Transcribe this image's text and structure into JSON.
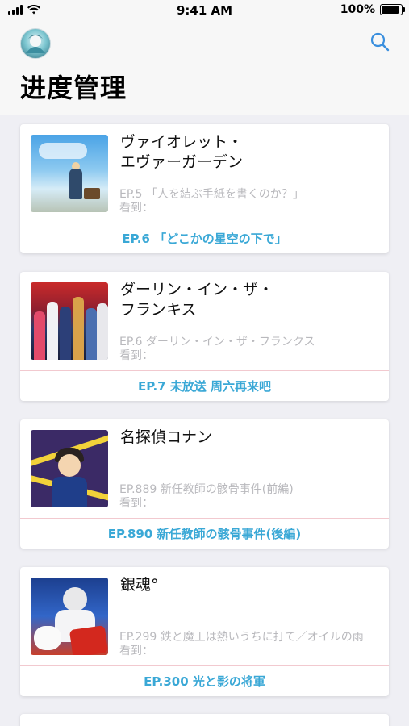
{
  "status_bar": {
    "time": "9:41 AM",
    "battery_text": "100%",
    "battery_level": 1.0
  },
  "header": {
    "title": "进度管理",
    "search_icon": "search-icon",
    "avatar_icon": "avatar"
  },
  "colors": {
    "accent": "#3aa8d6",
    "muted_text": "#b9b9bd",
    "divider": "#f2c9cf",
    "background": "#efeff4"
  },
  "shows": [
    {
      "title": "ヴァイオレット・\nエヴァーガーデン",
      "last_episode": "EP.5 「人を結ぶ手紙を書くのか？」",
      "watched_label": "看到：",
      "next_episode": "EP.6 「どこかの星空の下で」"
    },
    {
      "title": "ダーリン・イン・ザ・\nフランキス",
      "last_episode": "EP.6 ダーリン・イン・ザ・フランクス",
      "watched_label": "看到：",
      "next_episode": "EP.7 未放送 周六再来吧"
    },
    {
      "title": "名探偵コナン",
      "last_episode": "EP.889 新任教師の骸骨事件(前編)",
      "watched_label": "看到：",
      "next_episode": "EP.890 新任教師の骸骨事件(後編)"
    },
    {
      "title": "銀魂°",
      "last_episode": "EP.299 鉄と魔王は熱いうちに打て／オイルの雨",
      "watched_label": "看到：",
      "next_episode": "EP.300 光と影の将軍"
    }
  ]
}
